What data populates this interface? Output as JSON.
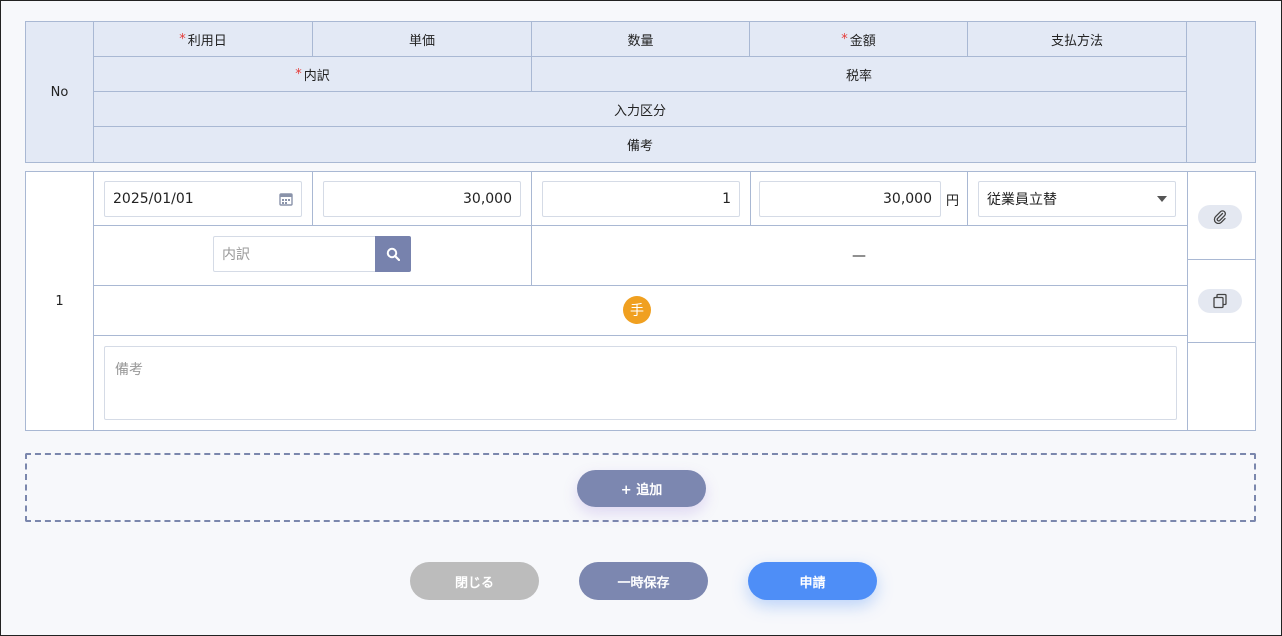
{
  "header": {
    "no": "No",
    "use_date": "利用日",
    "unit_price": "単価",
    "quantity": "数量",
    "amount": "金額",
    "payment_method": "支払方法",
    "breakdown": "内訳",
    "tax_rate": "税率",
    "input_category": "入力区分",
    "remarks": "備考",
    "required_mark": "*"
  },
  "row": {
    "no": "1",
    "date_value": "2025/01/01",
    "unit_price_value": "30,000",
    "quantity_value": "1",
    "amount_value": "30,000",
    "amount_unit": "円",
    "payment_method_value": "従業員立替",
    "breakdown_placeholder": "内訳",
    "tax_rate_value": "—",
    "input_category_badge": "手",
    "remarks_placeholder": "備考"
  },
  "actions": {
    "add_label": "+ 追加",
    "close_label": "閉じる",
    "temp_save_label": "一時保存",
    "submit_label": "申請"
  },
  "colors": {
    "accent": "#4e8ef7",
    "secondary": "#7c87b0",
    "disabled": "#bdbdbd",
    "required": "#e53935",
    "badge": "#f0a020"
  },
  "icons": {
    "calendar": "calendar-icon",
    "search": "search-icon",
    "dropdown": "caret-down-icon",
    "attachment": "paperclip-icon",
    "copy": "copy-icon"
  }
}
